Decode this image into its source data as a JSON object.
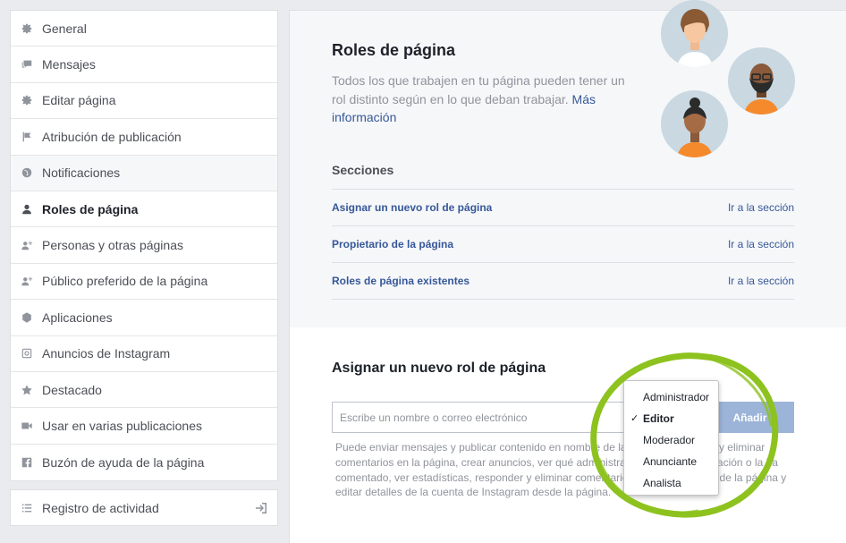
{
  "sidebar": {
    "items": [
      {
        "label": "General",
        "icon": "gear-icon"
      },
      {
        "label": "Mensajes",
        "icon": "messages-icon"
      },
      {
        "label": "Editar página",
        "icon": "gear-icon"
      },
      {
        "label": "Atribución de publicación",
        "icon": "flag-icon"
      },
      {
        "label": "Notificaciones",
        "icon": "globe-icon"
      },
      {
        "label": "Roles de página",
        "icon": "person-icon"
      },
      {
        "label": "Personas y otras páginas",
        "icon": "person-plus-icon"
      },
      {
        "label": "Público preferido de la página",
        "icon": "person-plus-icon"
      },
      {
        "label": "Aplicaciones",
        "icon": "cube-icon"
      },
      {
        "label": "Anuncios de Instagram",
        "icon": "instagram-icon"
      },
      {
        "label": "Destacado",
        "icon": "star-icon"
      },
      {
        "label": "Usar en varias publicaciones",
        "icon": "video-icon"
      },
      {
        "label": "Buzón de ayuda de la página",
        "icon": "facebook-icon"
      }
    ],
    "activity_log": {
      "label": "Registro de actividad",
      "icon": "list-icon"
    }
  },
  "main": {
    "title": "Roles de página",
    "description": "Todos los que trabajen en tu página pueden tener un rol distinto según en lo que deban trabajar.",
    "more_info_link": "Más información",
    "sections_title": "Secciones",
    "sections": [
      {
        "label": "Asignar un nuevo rol de página",
        "go": "Ir a la sección"
      },
      {
        "label": "Propietario de la página",
        "go": "Ir a la sección"
      },
      {
        "label": "Roles de página existentes",
        "go": "Ir a la sección"
      }
    ]
  },
  "assign": {
    "title": "Asignar un nuevo rol de página",
    "input_placeholder": "Escribe un nombre o correo electrónico",
    "input_value": "",
    "add_button": "Añadir",
    "permissions_text": "Puede enviar mensajes y publicar contenido en nombre de la página, responder y eliminar comentarios en la página, crear anuncios, ver qué administrador creó una publicación o la ha comentado, ver estadísticas, responder y eliminar comentarios en Instagram desde la página y editar detalles de la cuenta de Instagram desde la página."
  },
  "role_dropdown": {
    "selected": "Editor",
    "options": [
      "Administrador",
      "Editor",
      "Moderador",
      "Anunciante",
      "Analista"
    ],
    "check_glyph": "✓"
  },
  "colors": {
    "link": "#365899",
    "highlight_circle": "#8dc21f",
    "add_button_disabled": "#9cb4d8"
  }
}
